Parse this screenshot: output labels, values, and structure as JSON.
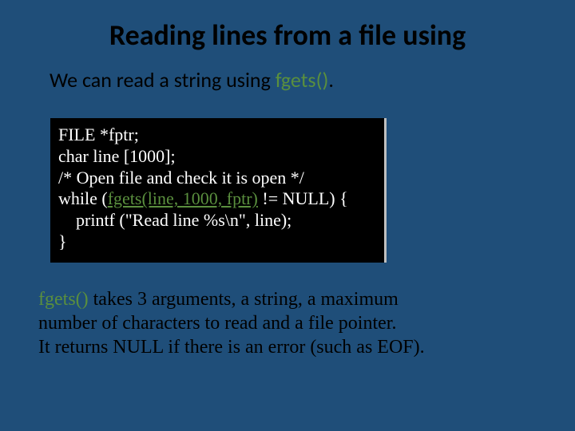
{
  "title": "Reading lines from a file using",
  "intro_prefix": "We can read a string using ",
  "intro_func": "fgets()",
  "intro_suffix": ".",
  "code": {
    "l1": "FILE *fptr;",
    "l2": "char line [1000];",
    "l3": "/* Open file and check it is open */",
    "l4a": "while (",
    "l4b": "fgets(line, 1000, fptr)",
    "l4c": " != NULL) {",
    "l5": "printf (\"Read line %s\\n\", line);",
    "l6": "}"
  },
  "desc": {
    "func": "fgets()",
    "rest1": " takes 3 arguments, a string, a maximum",
    "rest2": "number of characters to read and a file pointer.",
    "rest3": "It returns NULL if there is an error (such as EOF)."
  }
}
